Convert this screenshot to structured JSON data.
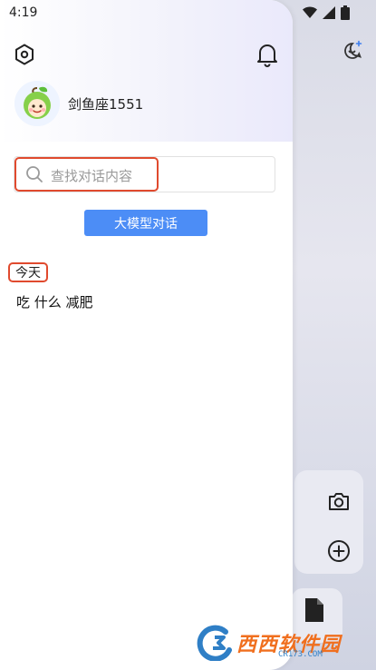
{
  "status_bar": {
    "time": "4:19"
  },
  "drawer": {
    "user": {
      "name": "剑鱼座1551"
    },
    "search": {
      "placeholder": "查找对话内容"
    },
    "model_chat_button": {
      "label": "大模型对话"
    },
    "history": {
      "sections": [
        {
          "label": "今天",
          "items": [
            {
              "title": "吃 什么 减肥"
            }
          ]
        }
      ]
    }
  },
  "colors": {
    "accent": "#4c8df6",
    "highlight": "#e04a2e"
  },
  "icons": {
    "settings": "settings-icon",
    "notifications": "bell-icon",
    "search": "search-icon",
    "new_chat": "new-chat-icon",
    "camera": "camera-icon",
    "add": "plus-icon",
    "file": "file-icon"
  },
  "watermark": {
    "brand": "西西软件园",
    "domain": "CR173.COM"
  }
}
